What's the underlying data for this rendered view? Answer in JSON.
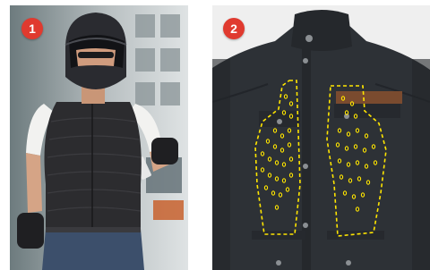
{
  "badges": [
    {
      "label": "1",
      "color": "#e03a2f"
    },
    {
      "label": "2",
      "color": "#e03a2f"
    }
  ],
  "panel_1": {
    "subject": "rider-in-cooling-vest-photo"
  },
  "panel_2": {
    "subject": "jacket-with-perforation-zones-photo",
    "outline_color": "#ffe500"
  }
}
